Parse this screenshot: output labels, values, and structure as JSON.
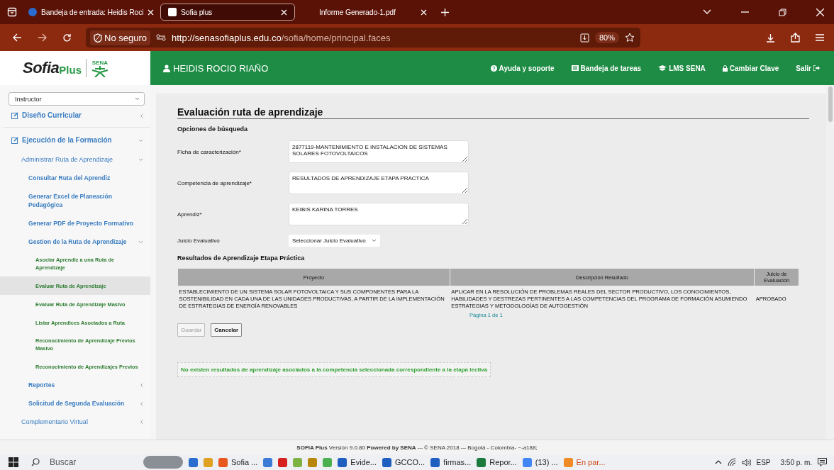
{
  "browser": {
    "tabs": [
      {
        "title": "Bandeja de entrada: Heidis Roci",
        "selected": false
      },
      {
        "title": "Sofia plus",
        "selected": true
      },
      {
        "title": "Informe Generado-1.pdf",
        "selected": false
      }
    ],
    "security": "No seguro",
    "url_host": "http://senasofiaplus.edu.co",
    "url_path": "/sofia/home/principal.faces",
    "zoom": "80%"
  },
  "header": {
    "logo": {
      "name": "Sofia",
      "suffix": "Plus",
      "emblem": "SENA"
    },
    "user": "HEIDIS ROCIO RIAÑO",
    "links": [
      "Ayuda y soporte",
      "Bandeja de tareas",
      "LMS SENA",
      "Cambiar Clave",
      "Salir"
    ]
  },
  "sidebar": {
    "role": "Instructor",
    "items": [
      {
        "label": "Diseño Curricular",
        "expanded": false,
        "selected": false
      },
      {
        "label": "Ejecución de la Formación",
        "expanded": true,
        "selected": false,
        "children": [
          {
            "label": "Administrar Ruta de Aprendizaje",
            "expanded": true,
            "selected": false,
            "children": [
              {
                "label": "Consultar Ruta del Aprendiz",
                "selected": false
              },
              {
                "label": "Generar Excel de Planeación Pedagógica",
                "selected": false
              },
              {
                "label": "Generar PDF de Proyecto Formativo",
                "selected": false
              },
              {
                "label": "Gestion de la Ruta de Aprendizaje",
                "expanded": true,
                "selected": false,
                "children": [
                  {
                    "label": "Asociar Aprendiz a una Ruta de Aprendizaje",
                    "selected": false
                  },
                  {
                    "label": "Evaluar Ruta de Aprendizaje",
                    "selected": true
                  },
                  {
                    "label": "Evaluar Ruta de Aprendizaje Masivo",
                    "selected": false
                  },
                  {
                    "label": "Listar Aprendices Asociados a Ruta",
                    "selected": false
                  },
                  {
                    "label": "Reconocimiento de Aprendizaje Previos Masivo",
                    "selected": false
                  },
                  {
                    "label": "Reconocimiento de Aprendizajes Previos",
                    "selected": false
                  }
                ]
              },
              {
                "label": "Reportes",
                "expanded": false,
                "selected": false
              },
              {
                "label": "Solicitud de Segunda Evaluación",
                "expanded": false,
                "selected": false
              }
            ]
          },
          {
            "label": "Complementario Virtual",
            "expanded": false,
            "selected": false
          }
        ]
      }
    ]
  },
  "page": {
    "title": "Evaluación ruta de aprendizaje",
    "search_heading": "Opciones de búsqueda",
    "fields": [
      {
        "label": "Ficha de caracterización*",
        "value": "2877119-MANTENIMIENTO E INSTALACION DE SISTEMAS SOLARES FOTOVOLTAICOS"
      },
      {
        "label": "Competencia de aprendizaje*",
        "value": "RESULTADOS DE APRENDIZAJE ETAPA PRACTICA"
      },
      {
        "label": "Aprendiz*",
        "value": "KEIBIS KARINA TORRES"
      }
    ],
    "judgement": {
      "label": "Juicio Evaluativo",
      "value": "Seleccionar Juicio Evaluativo"
    },
    "results_heading": "Resultados de Aprendizaje Etapa Práctica",
    "table": {
      "columns": [
        "Proyecto",
        "Descripción Resultado",
        "Juicio de Evaluación"
      ],
      "rows": [
        [
          "ESTABLECIMIENTO DE UN SISTEMA SOLAR FOTOVOLTAICA Y SUS COMPONENTES PARA LA SOSTENIBILIDAD EN CADA UNA DE LAS UNIDADES PRODUCTIVAS, A PARTIR DE LA IMPLEMENTACIÓN DE ESTRATEGIAS DE ENERGÍA RENOVABLES",
          "APLICAR EN LA RESOLUCIÓN DE PROBLEMAS REALES DEL SECTOR PRODUCTIVO, LOS CONOCIMIENTOS, HABILIDADES Y DESTREZAS PERTINENTES A LAS COMPETENCIAS DEL PROGRAMA DE FORMACIÓN ASUMIENDO ESTRATEGIAS Y METODOLOGÍAS DE AUTOGESTIÓN",
          "APROBADO"
        ]
      ],
      "pager": "Página 1 de 1"
    },
    "buttons": [
      {
        "label": "Guardar",
        "disabled": true
      },
      {
        "label": "Cancelar",
        "disabled": false
      }
    ],
    "message": "No existen resultados de aprendizaje asociados a la competencia seleccionada correspondiente a la etapa lectiva"
  },
  "footer": "**SOFIA Plus** Versión 9.0.80 **Powered by SENA** -– © SENA 2018 -– Bogotá - Colombia- ~-a188;",
  "taskbar": {
    "search": "Buscar",
    "items": [
      {
        "kind": "pinned"
      },
      {
        "kind": "pinned"
      },
      {
        "kind": "window",
        "label": "Sofia ..."
      },
      {
        "kind": "pinned"
      },
      {
        "kind": "pinned"
      },
      {
        "kind": "pinned"
      },
      {
        "kind": "pinned"
      },
      {
        "kind": "pinned"
      },
      {
        "kind": "window",
        "label": "Evide..."
      },
      {
        "kind": "window",
        "label": "GCCO..."
      },
      {
        "kind": "window",
        "label": "firmas..."
      },
      {
        "kind": "window",
        "label": "Repor..."
      },
      {
        "kind": "window",
        "label": "(13) ..."
      },
      {
        "kind": "alert",
        "label": "En par..."
      }
    ],
    "language": "ESP",
    "time": "3:50 p. m."
  }
}
